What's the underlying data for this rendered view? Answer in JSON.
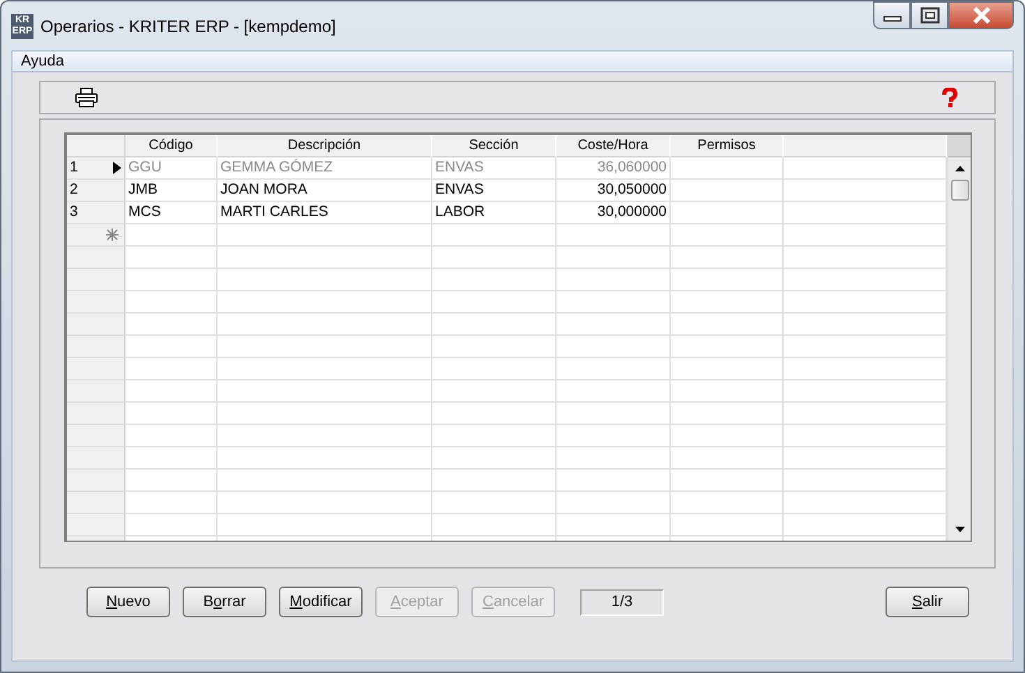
{
  "window": {
    "title": "Operarios - KRITER ERP - [kempdemo]",
    "logo": "KR ERP"
  },
  "menu": [
    "Ayuda"
  ],
  "table": {
    "columns": [
      "Código",
      "Descripción",
      "Sección",
      "Coste/Hora",
      "Permisos"
    ],
    "rows": [
      {
        "number": "1",
        "selected": true,
        "cells": [
          "GGU",
          "GEMMA GÓMEZ",
          "ENVAS",
          "36,060000"
        ]
      },
      {
        "number": "2",
        "selected": false,
        "cells": [
          "JMB",
          "JOAN MORA",
          "ENVAS",
          "30,050000"
        ]
      },
      {
        "number": "3",
        "selected": false,
        "cells": [
          "MCS",
          "MARTI CARLES",
          "LABOR",
          "30,000000"
        ]
      }
    ]
  },
  "buttons": [
    {
      "key": "N",
      "after": "uevo",
      "disabled": false
    },
    {
      "before": "B",
      "key": "o",
      "after": "rrar",
      "disabled": false
    },
    {
      "key": "M",
      "after": "odificar",
      "disabled": false
    },
    {
      "key": "A",
      "after": "ceptar",
      "disabled": true
    },
    {
      "key": "C",
      "after": "ancelar",
      "disabled": true
    }
  ],
  "record_counter": "1/3",
  "exit_button": {
    "key": "S",
    "after": "alir",
    "disabled": false
  }
}
